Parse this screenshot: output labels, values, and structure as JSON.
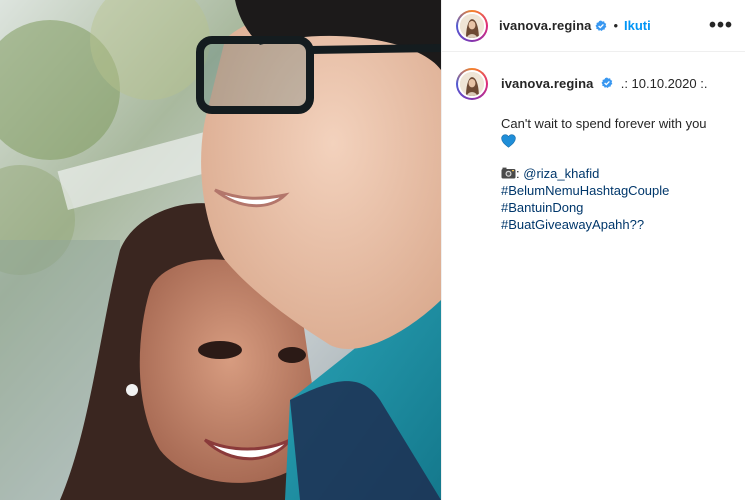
{
  "post": {
    "username": "ivanova.regina",
    "follow_label": "Ikuti",
    "separator": "•",
    "more_label": "•••"
  },
  "caption": {
    "username": "ivanova.regina",
    "date": ".: 10.10.2020 :.",
    "text": "Can't wait to spend forever with you",
    "credit_prefix": ":",
    "credit_handle": "@riza_khafid",
    "hashtags": [
      "#BelumNemuHashtagCouple",
      "#BantuinDong",
      "#BuatGiveawayApahh??"
    ]
  },
  "colors": {
    "accent_blue": "#0095f6",
    "link_blue": "#00376b",
    "verified_blue": "#3897f0",
    "heart_blue": "#1f8ed8",
    "text": "#262626"
  },
  "icons": [
    "verified-badge-icon",
    "more-options-icon",
    "blue-heart-icon",
    "camera-icon"
  ]
}
